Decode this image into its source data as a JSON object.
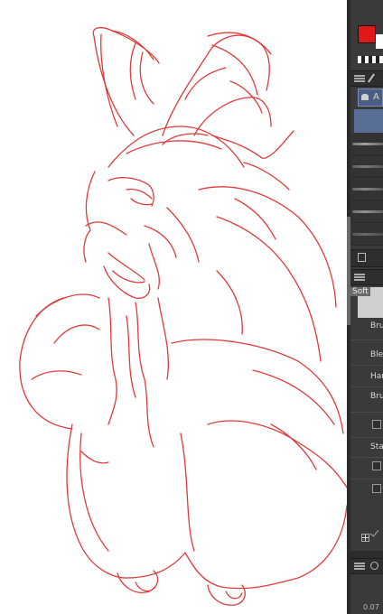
{
  "canvas": {
    "line_color": "#e03a3a",
    "background": "#ffffff"
  },
  "panel": {
    "main_color": "#e01818",
    "sub_color": "#ffffff",
    "tool_tab_label": "A",
    "property_header": "Soft",
    "properties": [
      {
        "label": "Bru"
      },
      {
        "label": "Ble"
      },
      {
        "label": "Har"
      },
      {
        "label": "Bru"
      },
      {
        "label": "Sta"
      }
    ],
    "readout": "0.07"
  }
}
